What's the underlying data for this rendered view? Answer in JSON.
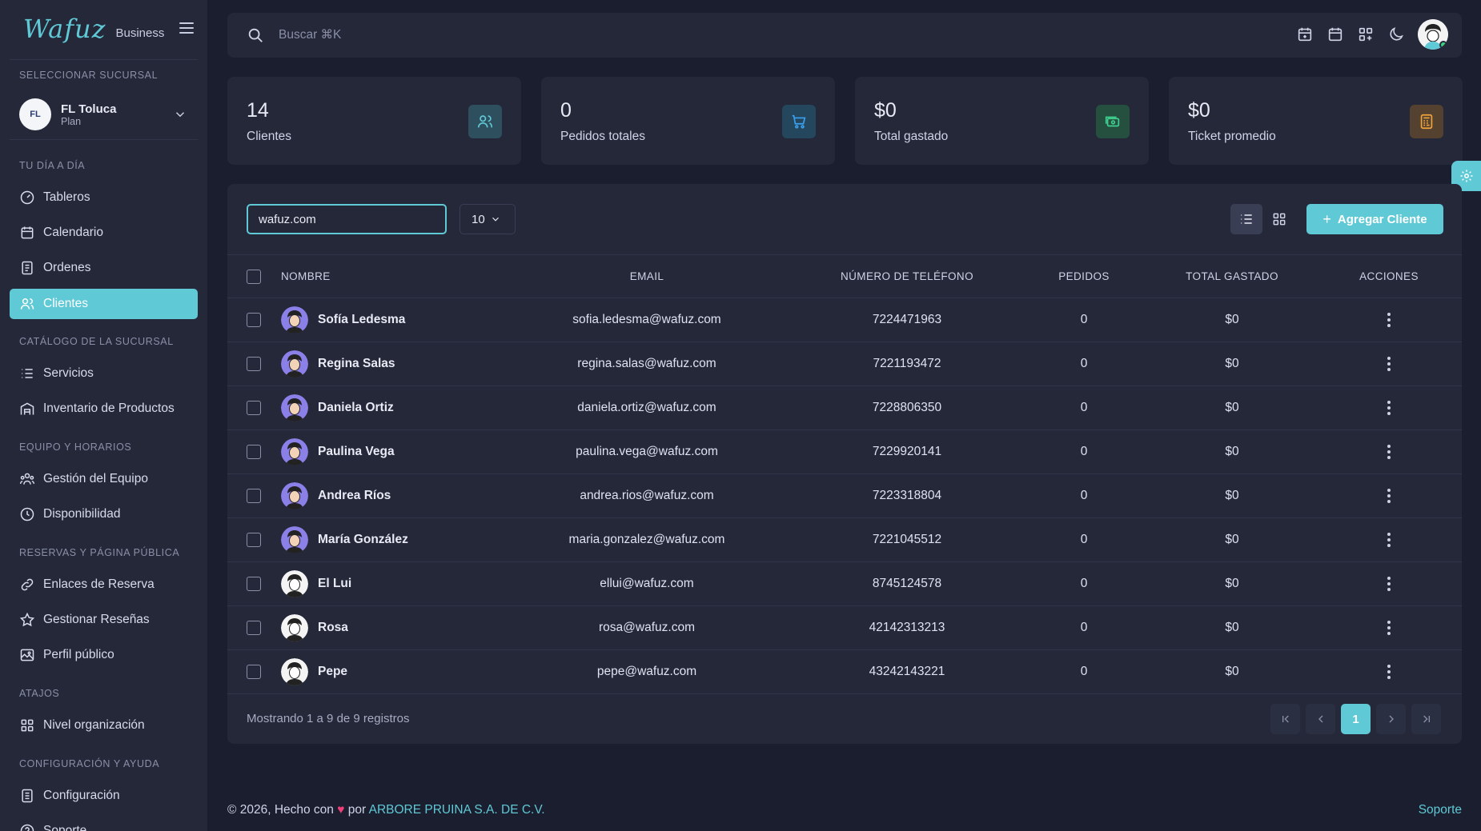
{
  "brand": {
    "logo": "Wafuz",
    "subtitle": "Business"
  },
  "sidebar": {
    "branch_section": "SELECCIONAR SUCURSAL",
    "branch": {
      "initials": "FL",
      "name": "FL Toluca",
      "plan": "Plan"
    },
    "sections": [
      {
        "title": "TU DÍA A DÍA",
        "items": [
          {
            "label": "Tableros",
            "icon": "dashboard-icon"
          },
          {
            "label": "Calendario",
            "icon": "calendar-icon"
          },
          {
            "label": "Ordenes",
            "icon": "receipt-icon"
          },
          {
            "label": "Clientes",
            "icon": "users-icon",
            "active": true
          }
        ]
      },
      {
        "title": "CATÁLOGO DE LA SUCURSAL",
        "items": [
          {
            "label": "Servicios",
            "icon": "list-icon"
          },
          {
            "label": "Inventario de Productos",
            "icon": "warehouse-icon"
          }
        ]
      },
      {
        "title": "EQUIPO Y HORARIOS",
        "items": [
          {
            "label": "Gestión del Equipo",
            "icon": "team-icon"
          },
          {
            "label": "Disponibilidad",
            "icon": "clock-icon"
          }
        ]
      },
      {
        "title": "RESERVAS Y PÁGINA PÚBLICA",
        "items": [
          {
            "label": "Enlaces de Reserva",
            "icon": "link-icon"
          },
          {
            "label": "Gestionar Reseñas",
            "icon": "star-icon"
          },
          {
            "label": "Perfil público",
            "icon": "image-icon"
          }
        ]
      },
      {
        "title": "ATAJOS",
        "items": [
          {
            "label": "Nivel organización",
            "icon": "grid-icon"
          }
        ]
      },
      {
        "title": "CONFIGURACIÓN Y AYUDA",
        "items": [
          {
            "label": "Configuración",
            "icon": "settings-list-icon"
          },
          {
            "label": "Soporte",
            "icon": "help-icon"
          }
        ]
      }
    ]
  },
  "topbar": {
    "search_placeholder": "Buscar ⌘K"
  },
  "stats": [
    {
      "value": "14",
      "label": "Clientes",
      "color": "#5fc9d6"
    },
    {
      "value": "0",
      "label": "Pedidos totales",
      "color": "#3aa0f0"
    },
    {
      "value": "$0",
      "label": "Total gastado",
      "color": "#3fcf8e"
    },
    {
      "value": "$0",
      "label": "Ticket promedio",
      "color": "#f0a43a"
    }
  ],
  "toolbar": {
    "filter_value": "wafuz.com",
    "per_page": "10",
    "add_label": "Agregar Cliente"
  },
  "table": {
    "headers": {
      "name": "NOMBRE",
      "email": "EMAIL",
      "phone": "NÚMERO DE TELÉFONO",
      "orders": "PEDIDOS",
      "spent": "TOTAL GASTADO",
      "actions": "ACCIONES"
    },
    "rows": [
      {
        "name": "Sofía Ledesma",
        "email": "sofia.ledesma@wafuz.com",
        "phone": "7224471963",
        "orders": "0",
        "spent": "$0",
        "avatar": "purple"
      },
      {
        "name": "Regina Salas",
        "email": "regina.salas@wafuz.com",
        "phone": "7221193472",
        "orders": "0",
        "spent": "$0",
        "avatar": "purple"
      },
      {
        "name": "Daniela Ortiz",
        "email": "daniela.ortiz@wafuz.com",
        "phone": "7228806350",
        "orders": "0",
        "spent": "$0",
        "avatar": "purple"
      },
      {
        "name": "Paulina Vega",
        "email": "paulina.vega@wafuz.com",
        "phone": "7229920141",
        "orders": "0",
        "spent": "$0",
        "avatar": "purple"
      },
      {
        "name": "Andrea Ríos",
        "email": "andrea.rios@wafuz.com",
        "phone": "7223318804",
        "orders": "0",
        "spent": "$0",
        "avatar": "purple"
      },
      {
        "name": "María González",
        "email": "maria.gonzalez@wafuz.com",
        "phone": "7221045512",
        "orders": "0",
        "spent": "$0",
        "avatar": "purple"
      },
      {
        "name": "El Lui",
        "email": "ellui@wafuz.com",
        "phone": "8745124578",
        "orders": "0",
        "spent": "$0",
        "avatar": "white"
      },
      {
        "name": "Rosa",
        "email": "rosa@wafuz.com",
        "phone": "42142313213",
        "orders": "0",
        "spent": "$0",
        "avatar": "white"
      },
      {
        "name": "Pepe",
        "email": "pepe@wafuz.com",
        "phone": "43242143221",
        "orders": "0",
        "spent": "$0",
        "avatar": "white"
      }
    ],
    "footer": "Mostrando 1 a 9 de 9 registros",
    "current_page": "1"
  },
  "footer": {
    "copyright_prefix": "© 2026, Hecho con",
    "by": "por",
    "company": "ARBORE PRUINA S.A. DE C.V.",
    "support": "Soporte"
  }
}
